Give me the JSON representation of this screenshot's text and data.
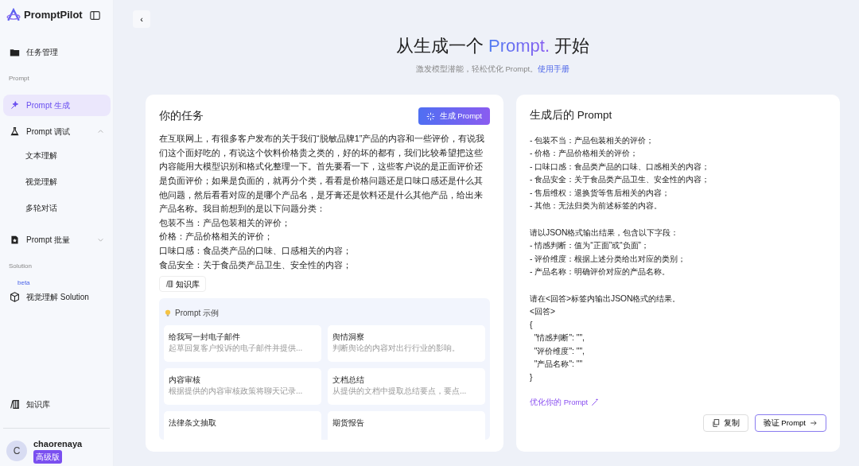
{
  "sidebar": {
    "logo": "PromptPilot",
    "items": [
      {
        "kind": "item",
        "label": "任务管理",
        "selected": false
      },
      {
        "kind": "section",
        "label": "Prompt"
      },
      {
        "kind": "item",
        "label": "Prompt 生成",
        "selected": true
      },
      {
        "kind": "item",
        "label": "Prompt 调试",
        "selected": false,
        "expanded": true,
        "children": [
          {
            "label": "文本理解",
            "selected": false
          },
          {
            "label": "视觉理解",
            "selected": false
          },
          {
            "label": "多轮对话",
            "selected": false
          }
        ]
      },
      {
        "kind": "item",
        "label": "Prompt 批量",
        "selected": false,
        "expanded": false
      },
      {
        "kind": "section",
        "label": "Solution"
      },
      {
        "kind": "item",
        "label": "视觉理解 Solution",
        "selected": false,
        "badge": "beta"
      }
    ],
    "footer_link": "知识库",
    "user": {
      "initial": "C",
      "name": "chaorenaya",
      "plan": "高级版"
    }
  },
  "collapse_button": "‹",
  "hero": {
    "title_before": "从生成一个 ",
    "title_highlight": "Prompt.",
    "title_after": " 开始",
    "subtitle": "激发模型潜能，轻松优化 Prompt。",
    "manual_link": "使用手册"
  },
  "task_panel": {
    "title": "你的任务",
    "generate_button": "生成 Prompt",
    "lines": [
      "在互联网上，有很多客户发布的关于我们“脱敏品牌1”产品的内容和一些评价，有说我们这个面好吃的，有说这个饮料价格贵之类的，好的坏的都有，我们比较希望把这些内容能用大模型识别和格式化整理一下。首先要看一下，这些客户说的是正面评价还是负面评价；如果是负面的，就再分个类，看看是价格问题还是口味口感还是什么其他问题，然后看看对应的是哪个产品名，是牙膏还是饮料还是什么其他产品，给出来产品名称。我目前想到的是以下问题分类：",
      "包装不当：产品包装相关的评价；",
      "价格：产品价格相关的评价；",
      "口味口感：食品类产品的口味、口感相关的内容；",
      "食品安全：关于食品类产品卫生、安全性的内容；"
    ],
    "knowledge_button": "知识库",
    "examples": {
      "title": "Prompt 示例",
      "items": [
        {
          "title": "给我写一封电子邮件",
          "description": "起草回复客户投诉的电子邮件并提供..."
        },
        {
          "title": "舆情洞察",
          "description": "判断舆论的内容对出行行业的影响。"
        },
        {
          "title": "内容审核",
          "description": "根据提供的内容审核政策将聊天记录..."
        },
        {
          "title": "文档总结",
          "description": "从提供的文档中提取总结要点，要点..."
        },
        {
          "title": "法律条文抽取"
        },
        {
          "title": "期货报告"
        }
      ]
    }
  },
  "result_panel": {
    "title": "生成后的 Prompt",
    "blocks": [
      [
        "- 包装不当：产品包装相关的评价；",
        "- 价格：产品价格相关的评价；",
        "- 口味口感：食品类产品的口味、口感相关的内容；",
        "- 食品安全：关于食品类产品卫生、安全性的内容；",
        "- 售后维权：退换货等售后相关的内容；",
        "- 其他：无法归类为前述标签的内容。"
      ],
      [
        "请以JSON格式输出结果，包含以下字段：",
        "- 情感判断：值为“正面”或“负面”；",
        "- 评价维度：根据上述分类给出对应的类别；",
        "- 产品名称：明确评价对应的产品名称。"
      ],
      [
        "请在<回答>标签内输出JSON格式的结果。",
        "<回答>",
        "{",
        "  \"情感判断\": \"\",",
        "  \"评价维度\": \"\",",
        "  \"产品名称\": \"\"",
        "}"
      ]
    ],
    "optimize_link": "优化你的 Prompt",
    "copy_button": "复制",
    "verify_button": "验证 Prompt"
  }
}
